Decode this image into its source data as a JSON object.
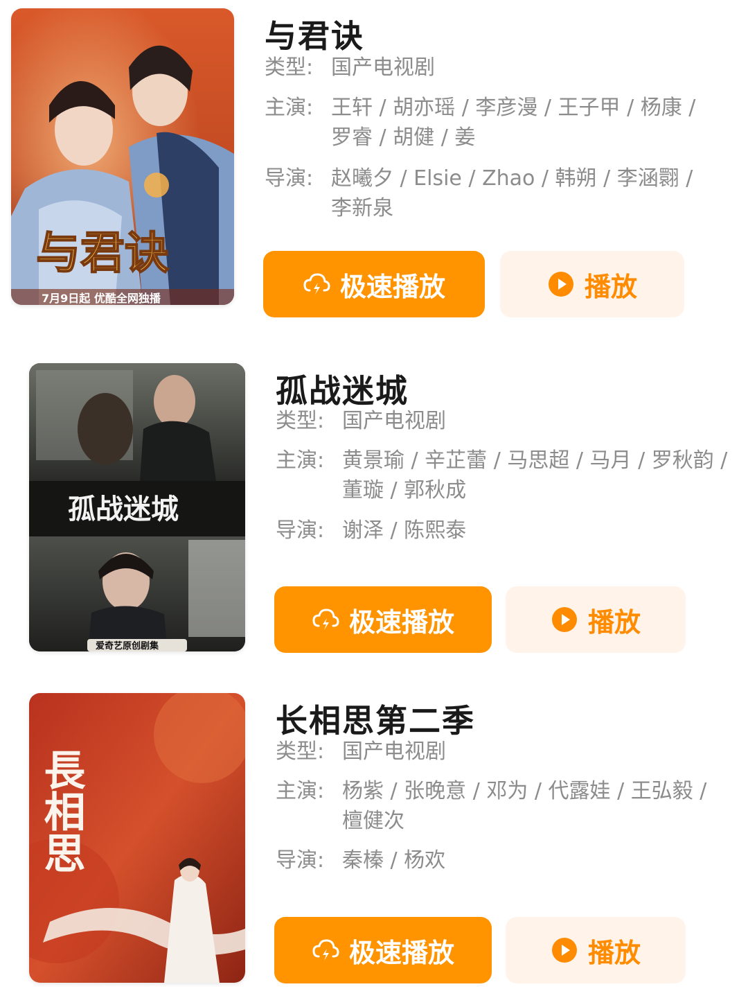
{
  "accent_color": "#ff9400",
  "play_bg_color": "#fff3ea",
  "items": [
    {
      "title": "与君诀",
      "type_label": "类型:",
      "type_value": "国产电视剧",
      "cast_label": "主演:",
      "cast_value": "王轩 / 胡亦瑶 / 李彦漫 / 王子甲 / 杨康 / 罗睿 / 胡健 / 姜",
      "director_label": "导演:",
      "director_value": "赵曦夕 / Elsie / Zhao / 韩朔 / 李涵翾 / 李新泉",
      "fast_play_label": "极速播放",
      "play_label": "播放",
      "poster_title": "与君诀",
      "poster_caption": "7月9日起 优酷全网独播"
    },
    {
      "title": "孤战迷城",
      "type_label": "类型:",
      "type_value": "国产电视剧",
      "cast_label": "主演:",
      "cast_value": "黄景瑜 / 辛芷蕾 / 马思超 / 马月 / 罗秋韵 / 董璇 / 郭秋成",
      "director_label": "导演:",
      "director_value": "谢泽 / 陈熙泰",
      "fast_play_label": "极速播放",
      "play_label": "播放",
      "poster_title": "孤战迷城",
      "poster_caption": "爱奇艺原创剧集"
    },
    {
      "title": "长相思第二季",
      "type_label": "类型:",
      "type_value": "国产电视剧",
      "cast_label": "主演:",
      "cast_value": "杨紫 / 张晚意 / 邓为 / 代露娃 / 王弘毅 / 檀健次",
      "director_label": "导演:",
      "director_value": "秦榛 / 杨欢",
      "fast_play_label": "极速播放",
      "play_label": "播放",
      "poster_title": "長相思",
      "poster_caption": ""
    }
  ]
}
